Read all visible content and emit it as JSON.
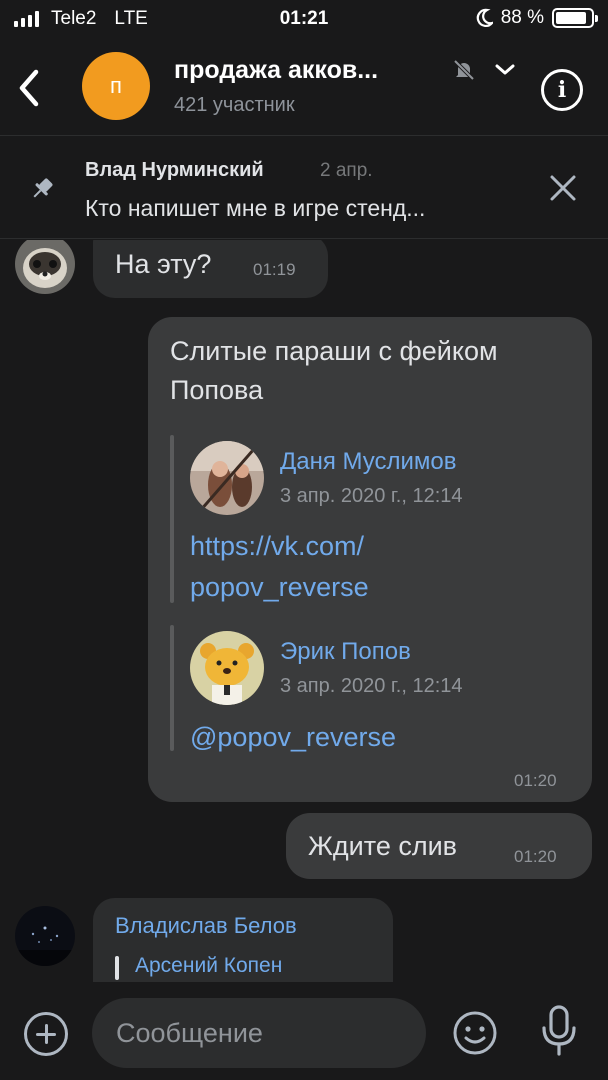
{
  "status": {
    "carrier": "Tele2",
    "network": "LTE",
    "time": "01:21",
    "battery_text": "88 %",
    "battery_level": 0.88
  },
  "header": {
    "avatar_letter": "п",
    "title": "продажа акков...",
    "subtitle": "421 участник"
  },
  "pinned": {
    "author": "Влад Нурминский",
    "date": "2 апр.",
    "text": "Кто напишет мне в игре стенд..."
  },
  "messages": {
    "m1": {
      "text": "На эту?",
      "time": "01:19"
    },
    "m2": {
      "text_line1": "Слитые параши с фейком",
      "text_line2": "Попова",
      "time": "01:20",
      "fwd1": {
        "name": "Даня Муслимов",
        "date": "3 апр. 2020 г., 12:14",
        "link_line1": "https://vk.com/",
        "link_line2": "popov_reverse"
      },
      "fwd2": {
        "name": "Эрик Попов",
        "date": "3 апр. 2020 г., 12:14",
        "mention": "@popov_reverse"
      }
    },
    "m3": {
      "text": "Ждите слив",
      "time": "01:20"
    },
    "m4": {
      "author": "Владислав Белов",
      "reply_author": "Арсений Копен"
    }
  },
  "composer": {
    "placeholder": "Сообщение"
  },
  "colors": {
    "background": "#19191a",
    "bubble_in": "#2c2d2e",
    "bubble_out": "#3a3b3c",
    "link": "#71aaeb",
    "chat_avatar": "#f29b1f"
  },
  "icons": [
    "back-icon",
    "mute-icon",
    "chevron-down-icon",
    "info-icon",
    "pin-icon",
    "close-icon",
    "add-icon",
    "emoji-icon",
    "mic-icon"
  ]
}
